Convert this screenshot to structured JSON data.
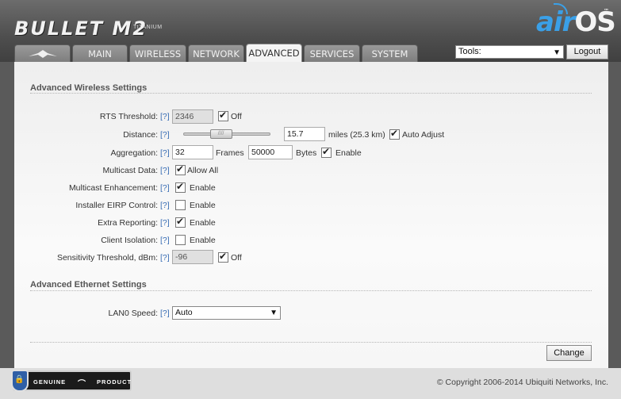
{
  "header": {
    "brand": "BULLET M2",
    "brand_sub": "TITANIUM",
    "os_air": "air",
    "os_os": "OS",
    "os_tm": "™"
  },
  "tabs": [
    {
      "label": "MAIN"
    },
    {
      "label": "WIRELESS"
    },
    {
      "label": "NETWORK"
    },
    {
      "label": "ADVANCED",
      "active": true
    },
    {
      "label": "SERVICES"
    },
    {
      "label": "SYSTEM"
    }
  ],
  "toolbar": {
    "tools_value": "Tools:",
    "logout_label": "Logout"
  },
  "wireless": {
    "title": "Advanced Wireless Settings",
    "help": "[?]",
    "rts": {
      "label": "RTS Threshold:",
      "value": "2346",
      "off_label": "Off",
      "off_checked": true
    },
    "distance": {
      "label": "Distance:",
      "value": "15.7",
      "unit_text": "miles (25.3 km)",
      "auto_label": "Auto Adjust",
      "auto_checked": true,
      "slider_fraction": 0.41
    },
    "aggregation": {
      "label": "Aggregation:",
      "frames": "32",
      "frames_label": "Frames",
      "bytes": "50000",
      "bytes_label": "Bytes",
      "enable_label": "Enable",
      "enable_checked": true
    },
    "multicast": {
      "label": "Multicast Data:",
      "option_label": "Allow All",
      "checked": true
    },
    "multicast_enh": {
      "label": "Multicast Enhancement:",
      "option_label": "Enable",
      "checked": true
    },
    "eirp": {
      "label": "Installer EIRP Control:",
      "option_label": "Enable",
      "checked": false
    },
    "extra_reporting": {
      "label": "Extra Reporting:",
      "option_label": "Enable",
      "checked": true
    },
    "client_isolation": {
      "label": "Client Isolation:",
      "option_label": "Enable",
      "checked": false
    },
    "sensitivity": {
      "label": "Sensitivity Threshold, dBm:",
      "value": "-96",
      "off_label": "Off",
      "off_checked": true
    }
  },
  "ethernet": {
    "title": "Advanced Ethernet Settings",
    "lan0": {
      "label": "LAN0 Speed:",
      "value": "Auto"
    }
  },
  "actions": {
    "change_label": "Change"
  },
  "footer": {
    "badge_left": "GENUINE",
    "badge_right": "PRODUCT",
    "copyright": "© Copyright 2006-2014 Ubiquiti Networks, Inc."
  },
  "colors": {
    "accent_blue": "#3aa0e8",
    "help_link": "#3a6eb5",
    "badge_shield": "#2f5fa6"
  }
}
